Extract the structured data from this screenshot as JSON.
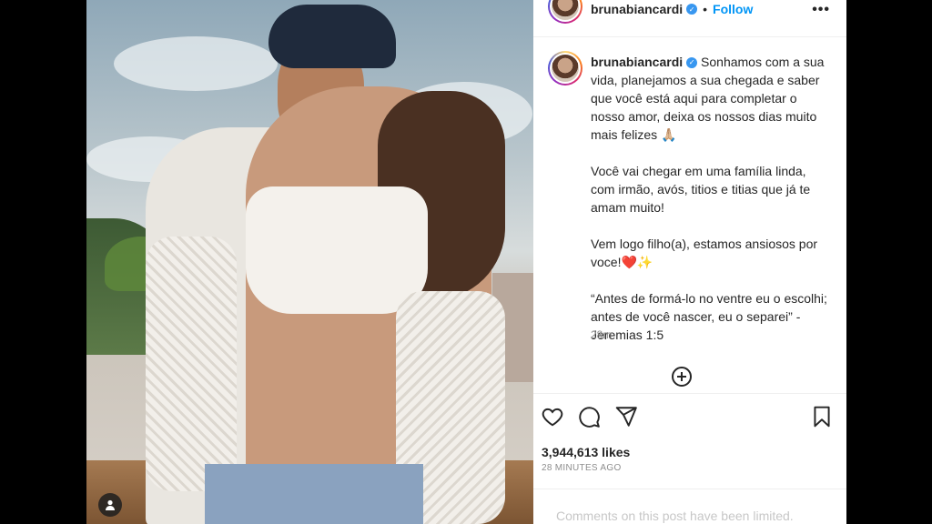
{
  "post": {
    "username": "brunabiancardi",
    "follow_label": "Follow",
    "more_label": "•••",
    "verified_mark": "✓",
    "caption": [
      "Sonhamos com a sua vida, planejamos a sua chegada e saber que você está aqui para completar o nosso amor, deixa os nossos dias muito mais felizes 🙏🏼",
      "Você vai chegar em uma família linda, com irmão, avós, titios e titias que já te amam muito!",
      "Vem logo filho(a), estamos ansiosos por voce!❤️✨",
      "“Antes de formá-lo no ventre eu o escolhi; antes de você nascer, eu o separei” - Jeremias 1:5"
    ],
    "time": "28m",
    "likes": "3,944,613 likes",
    "posted_ago": "28 MINUTES AGO",
    "comments_note": "Comments on this post have been limited."
  },
  "icons": {
    "like": "heart-icon",
    "comment": "comment-icon",
    "share": "share-icon",
    "save": "bookmark-icon",
    "add_comment": "plus-circle-icon",
    "tagged_user": "user-tag-icon"
  },
  "colors": {
    "link": "#0095f6",
    "verified": "#3897f0",
    "text": "#262626",
    "muted": "#8e8e8e"
  }
}
